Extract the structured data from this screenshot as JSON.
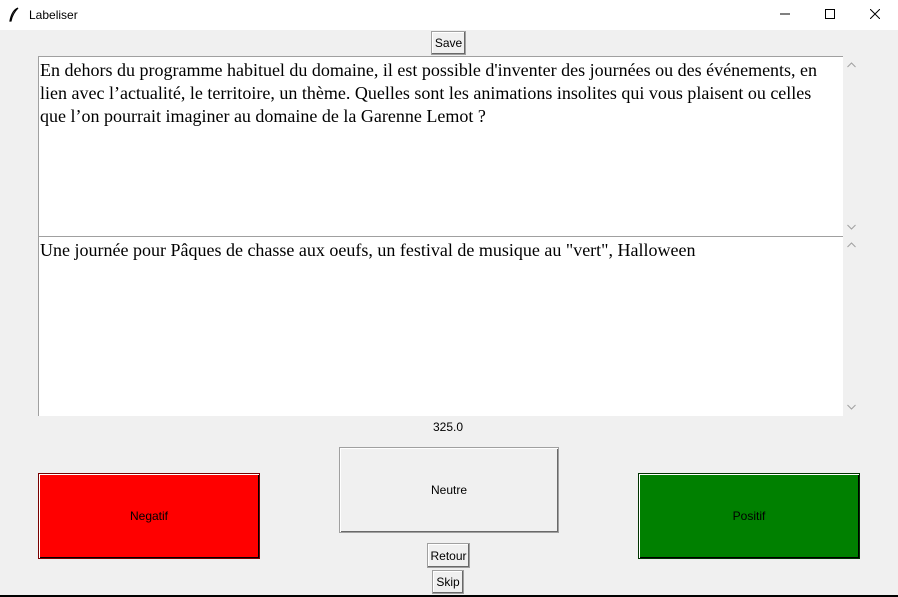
{
  "window": {
    "title": "Labeliser",
    "icons": {
      "app": "feather-icon",
      "minimize": "minimize-icon",
      "maximize": "maximize-icon",
      "close": "close-icon"
    }
  },
  "toolbar": {
    "save_label": "Save"
  },
  "question_text": "En dehors du programme habituel du domaine, il est possible d'inventer des journées ou des événements, en lien avec l’actualité, le territoire, un thème. Quelles sont les animations insolites qui vous plaisent ou celles que l’on pourrait imaginer au domaine de la Garenne Lemot ?",
  "answer_text": "Une journée pour Pâques de chasse aux oeufs, un festival de musique au \"vert\", Halloween",
  "score": "325.0",
  "labels": {
    "negatif": "Negatif",
    "neutre": "Neutre",
    "positif": "Positif"
  },
  "colors": {
    "negatif": "#ff0000",
    "neutre": "#f0f0f0",
    "positif": "#008000"
  },
  "nav": {
    "retour_label": "Retour",
    "skip_label": "Skip"
  }
}
